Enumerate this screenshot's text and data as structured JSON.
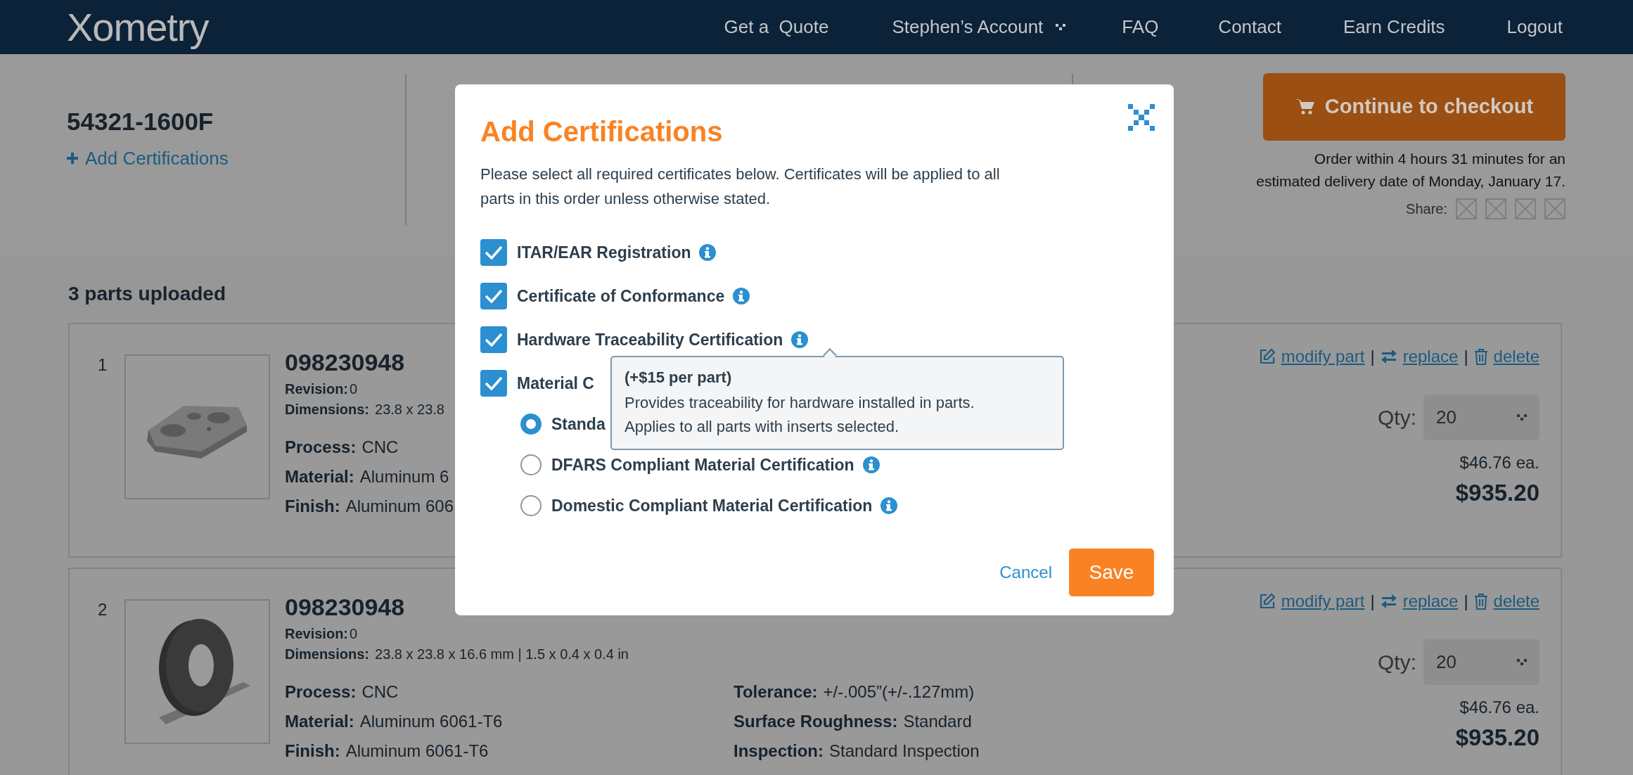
{
  "nav": {
    "logo": "Xometry",
    "links": [
      {
        "label": "Get a  Quote",
        "dropdown": false
      },
      {
        "label": "Stephen’s Account",
        "dropdown": true
      },
      {
        "label": "FAQ",
        "dropdown": false
      },
      {
        "label": "Contact",
        "dropdown": false
      },
      {
        "label": "Earn Credits",
        "dropdown": false
      },
      {
        "label": "Logout",
        "dropdown": false
      }
    ]
  },
  "order": {
    "part_number": "54321-1600F",
    "add_certifications": "Add Certifications",
    "checkout_button": "Continue to checkout",
    "delivery_note": "Order within 4 hours 31 minutes for an\nestimated delivery date of Monday, January 17.",
    "share_label": "Share:"
  },
  "parts_heading": "3 parts uploaded",
  "parts": [
    {
      "number": "1",
      "kind": "plate",
      "part_id": "098230948",
      "revision": {
        "label": "Revision:",
        "value": "0"
      },
      "dimensions": {
        "label": "Dimensions:",
        "value": "23.8 x 23.8"
      },
      "specs": [
        {
          "label": "Process:",
          "value": "CNC"
        },
        {
          "label": "Material:",
          "value": "Aluminum 6"
        },
        {
          "label": "Finish:",
          "value": "Aluminum 606"
        }
      ],
      "actions": [
        {
          "label": "modify part",
          "kind": "edit"
        },
        {
          "separator": "|",
          "label": "replace",
          "kind": "swap"
        },
        {
          "separator": "|",
          "label": "delete",
          "kind": "trash"
        }
      ],
      "qty_label": "Qty:",
      "qty": "20",
      "unit_price": "$46.76 ea.",
      "total": "$935.20"
    },
    {
      "number": "2",
      "kind": "ring",
      "part_id": "098230948",
      "revision": {
        "label": "Revision:",
        "value": "0"
      },
      "dimensions": {
        "label": "Dimensions:",
        "value": "23.8 x 23.8 x 16.6 mm | 1.5 x 0.4 x 0.4 in"
      },
      "specs": [
        {
          "label": "Process:",
          "value": "CNC"
        },
        {
          "label": "Material:",
          "value": "Aluminum 6061-T6"
        },
        {
          "label": "Finish:",
          "value": "Aluminum 6061-T6"
        }
      ],
      "specs_2": [
        {
          "label": "Tolerance:",
          "value": "+/-.005”(+/-.127mm)"
        },
        {
          "label": "Surface Roughness:",
          "value": "Standard"
        },
        {
          "label": "Inspection:",
          "value": "Standard Inspection"
        }
      ],
      "actions": [
        {
          "label": "modify part",
          "kind": "edit"
        },
        {
          "separator": "|",
          "label": "replace",
          "kind": "swap"
        },
        {
          "separator": "|",
          "label": "delete",
          "kind": "trash"
        }
      ],
      "qty_label": "Qty:",
      "qty": "20",
      "unit_price": "$46.76 ea.",
      "total": "$935.20"
    }
  ],
  "modal": {
    "title": "Add Certifications",
    "description": "Please select all required certificates below. Certificates will be applied to all\nparts in this order unless otherwise stated.",
    "certifications": [
      {
        "label": "ITAR/EAR Registration",
        "checked": true,
        "info_icon": true
      },
      {
        "label": "Certificate of Conformance",
        "checked": true,
        "info_icon": true
      },
      {
        "label": "Hardware Traceability Certification",
        "checked": true,
        "info_icon": true
      },
      {
        "label": "Material C",
        "checked": true,
        "info_icon": false
      }
    ],
    "material_options": [
      {
        "label": "Standa",
        "selected": true,
        "info_icon": false
      },
      {
        "label": "DFARS Compliant Material Certification",
        "selected": false,
        "info_icon": true
      },
      {
        "label": "Domestic Compliant Material Certification",
        "selected": false,
        "info_icon": true
      }
    ],
    "tooltip": {
      "title": "(+$15 per part)",
      "text": "Provides traceability for hardware installed in parts.\nApplies to all parts with inserts selected."
    },
    "cancel": "Cancel",
    "save": "Save"
  }
}
